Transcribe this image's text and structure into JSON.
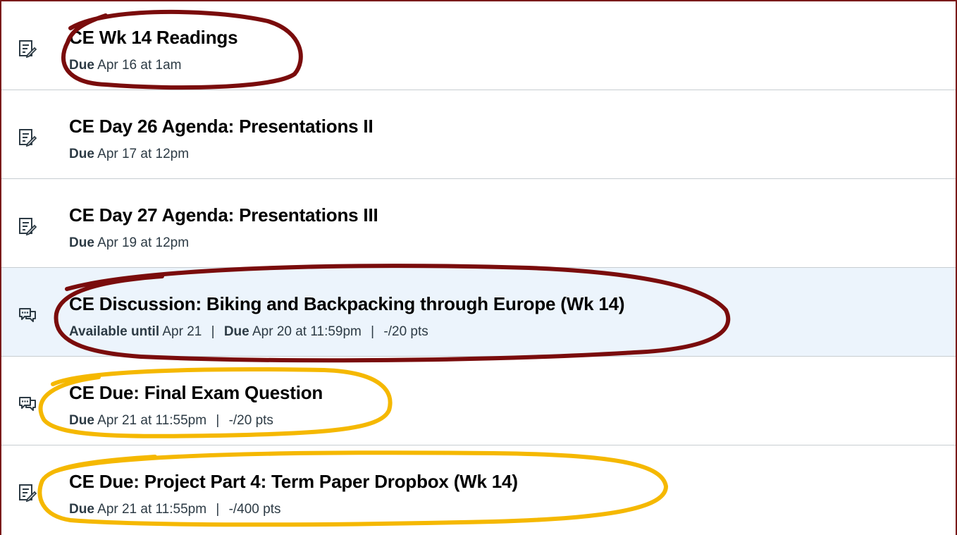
{
  "colors": {
    "highlight_row": "#ecf4fc",
    "divider": "#c7cdd1",
    "frame": "#7a1a1a",
    "annotation_dark": "#7a0c0c",
    "annotation_yellow": "#f5b800"
  },
  "items": [
    {
      "icon": "assignment-icon",
      "title": "CE Wk 14 Readings",
      "due_label": "Due",
      "due_value": "Apr 16 at 1am"
    },
    {
      "icon": "assignment-icon",
      "title": "CE Day 26 Agenda: Presentations II",
      "due_label": "Due",
      "due_value": "Apr 17 at 12pm"
    },
    {
      "icon": "assignment-icon",
      "title": "CE Day 27 Agenda: Presentations III",
      "due_label": "Due",
      "due_value": "Apr 19 at 12pm"
    },
    {
      "icon": "discussion-icon",
      "title": "CE Discussion: Biking and Backpacking through Europe (Wk 14)",
      "avail_label": "Available until",
      "avail_value": "Apr 21",
      "due_label": "Due",
      "due_value": "Apr 20 at 11:59pm",
      "points": "-/20 pts",
      "separator": "|"
    },
    {
      "icon": "discussion-icon",
      "title": "CE Due: Final Exam Question",
      "due_label": "Due",
      "due_value": "Apr 21 at 11:55pm",
      "points": "-/20 pts",
      "separator": "|"
    },
    {
      "icon": "assignment-icon",
      "title": "CE Due: Project Part 4: Term Paper Dropbox (Wk 14)",
      "due_label": "Due",
      "due_value": "Apr 21 at 11:55pm",
      "points": "-/400 pts",
      "separator": "|"
    }
  ]
}
